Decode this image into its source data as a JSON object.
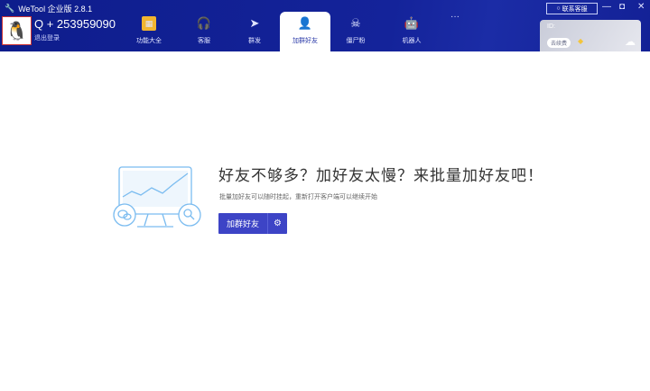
{
  "app": {
    "title": "WeTool 企业版 2.8.1"
  },
  "account": {
    "number": "Q + 253959090",
    "logout": "退出登录"
  },
  "tabs": [
    {
      "label": "功能大全"
    },
    {
      "label": "客服"
    },
    {
      "label": "群发"
    },
    {
      "label": "加群好友"
    },
    {
      "label": "僵尸粉"
    },
    {
      "label": "机器人"
    },
    {
      "label": "···"
    }
  ],
  "contact": "联系客服",
  "panel": {
    "id": "ID:",
    "renew": "去续费"
  },
  "main": {
    "headline": "好友不够多？加好友太慢？来批量加好友吧！",
    "sub": "批量加好友可以随时挂起，重新打开客户端可以继续开始",
    "button": "加群好友"
  },
  "colors": {
    "header": "#0e1d8c",
    "accent": "#3d44c6"
  }
}
